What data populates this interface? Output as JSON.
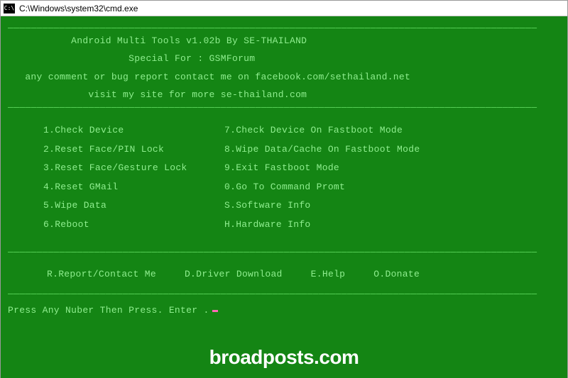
{
  "titlebar": {
    "icon_label": "C:\\",
    "path": "C:\\Windows\\system32\\cmd.exe"
  },
  "header": {
    "title": "Android Multi Tools v1.02b By SE-THAILAND",
    "special": "Special For : GSMForum",
    "contact": "any comment or bug report contact me on facebook.com/sethailand.net",
    "site": "visit my site for more se-thailand.com"
  },
  "menu": {
    "left": [
      "1.Check Device",
      "2.Reset Face/PIN Lock",
      "3.Reset Face/Gesture Lock",
      "4.Reset GMail",
      "5.Wipe Data",
      "6.Reboot"
    ],
    "right": [
      "7.Check Device On Fastboot Mode",
      "8.Wipe Data/Cache On Fastboot Mode",
      "9.Exit Fastboot Mode",
      "0.Go To Command Promt",
      "S.Software Info",
      "H.Hardware Info"
    ]
  },
  "bottom_menu": {
    "report": "R.Report/Contact Me",
    "driver": "D.Driver Download",
    "help": "E.Help",
    "donate": "O.Donate"
  },
  "prompt": "Press Any Nuber Then Press. Enter  .",
  "watermark": "broadposts.com",
  "divider": "————————————————————————————————————————————————————————————————————————————————————————————"
}
